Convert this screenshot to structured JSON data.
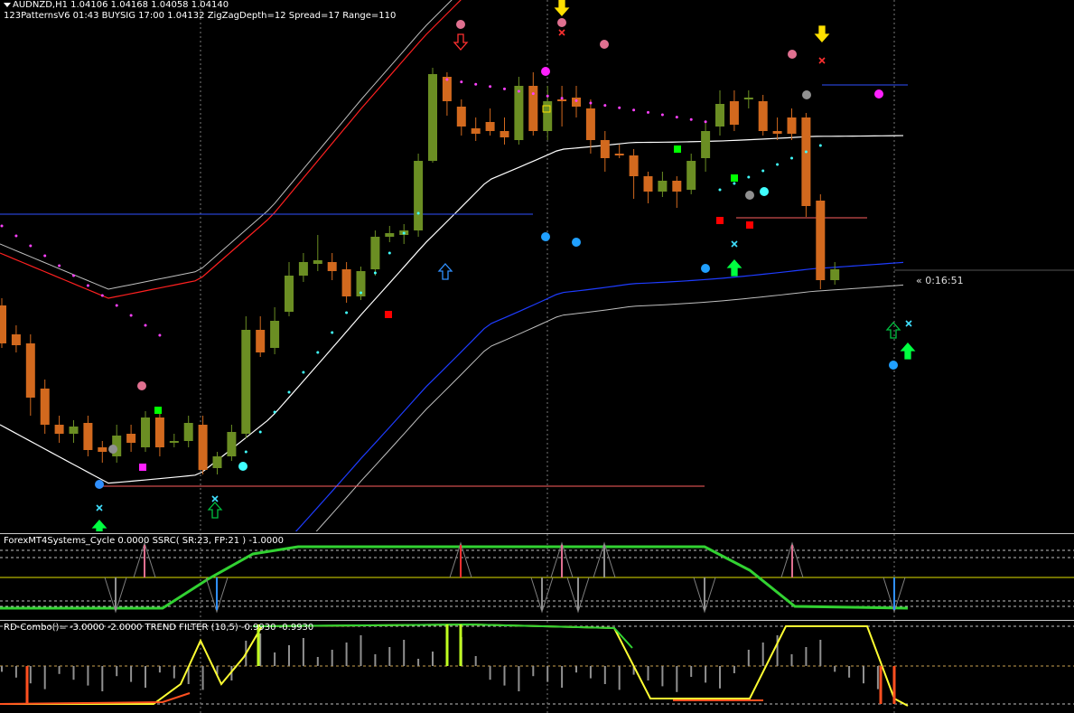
{
  "header": {
    "symbol_line": "AUDNZD,H1  1.04106 1.04168 1.04058 1.04140",
    "info_line": "123PatternsV6  01:43  BUYSIG  17:00  1.04132  ZigZagDepth=12  Spread=17  Range=110"
  },
  "timer_label": "« 0:16:51",
  "indicator1": {
    "label": "ForexMT4Systems_Cycle 0.0000  SSRC( SR:23, FP:21 ) -1.0000"
  },
  "indicator2": {
    "label": "RD-Combo()= -3.0000 -2.0000  TREND FILTER (10,5) -0.9930 -0.9930"
  },
  "colors": {
    "bull_candle": "#6b8e23",
    "bear_candle": "#d2691e",
    "upper_band": "#ff2020",
    "lower_band": "#1e3cff",
    "mid_line": "#ffffff",
    "grid": "#7a7a7a",
    "cycle_line": "#32d232",
    "combo_line": "#ffff32",
    "sr_line": "#ff6060"
  }
}
